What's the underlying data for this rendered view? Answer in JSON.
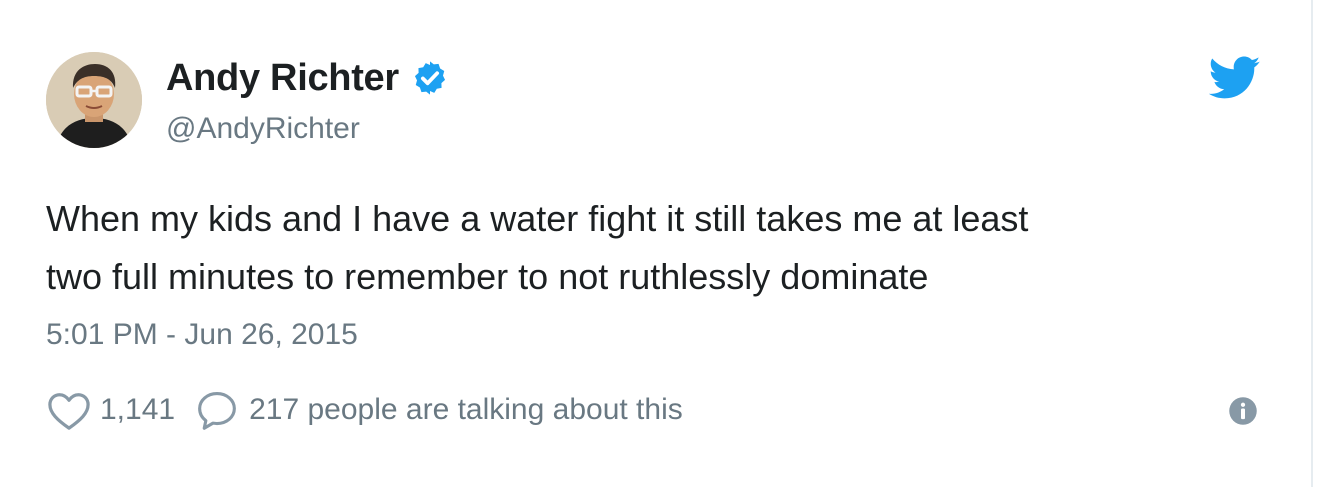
{
  "author": {
    "display_name": "Andy Richter",
    "screen_name": "@AndyRichter",
    "verified_icon": "verified-badge-icon",
    "avatar_icon": "avatar"
  },
  "brand": {
    "logo_icon": "twitter-bird-icon",
    "accent_color": "#1da1f2"
  },
  "tweet": {
    "text_lines": [
      "When my kids and I have a water fight it still takes me at least",
      "two full minutes to remember to not ruthlessly dominate"
    ],
    "timestamp": "5:01 PM - Jun 26, 2015"
  },
  "actions": {
    "like_icon": "heart-icon",
    "like_count": "1,141",
    "comment_icon": "comment-icon",
    "talking_text": "217 people are talking about this",
    "info_icon": "info-icon"
  },
  "colors": {
    "text": "#1c2022",
    "secondary_text": "#697882",
    "verified": "#1da1f2"
  }
}
